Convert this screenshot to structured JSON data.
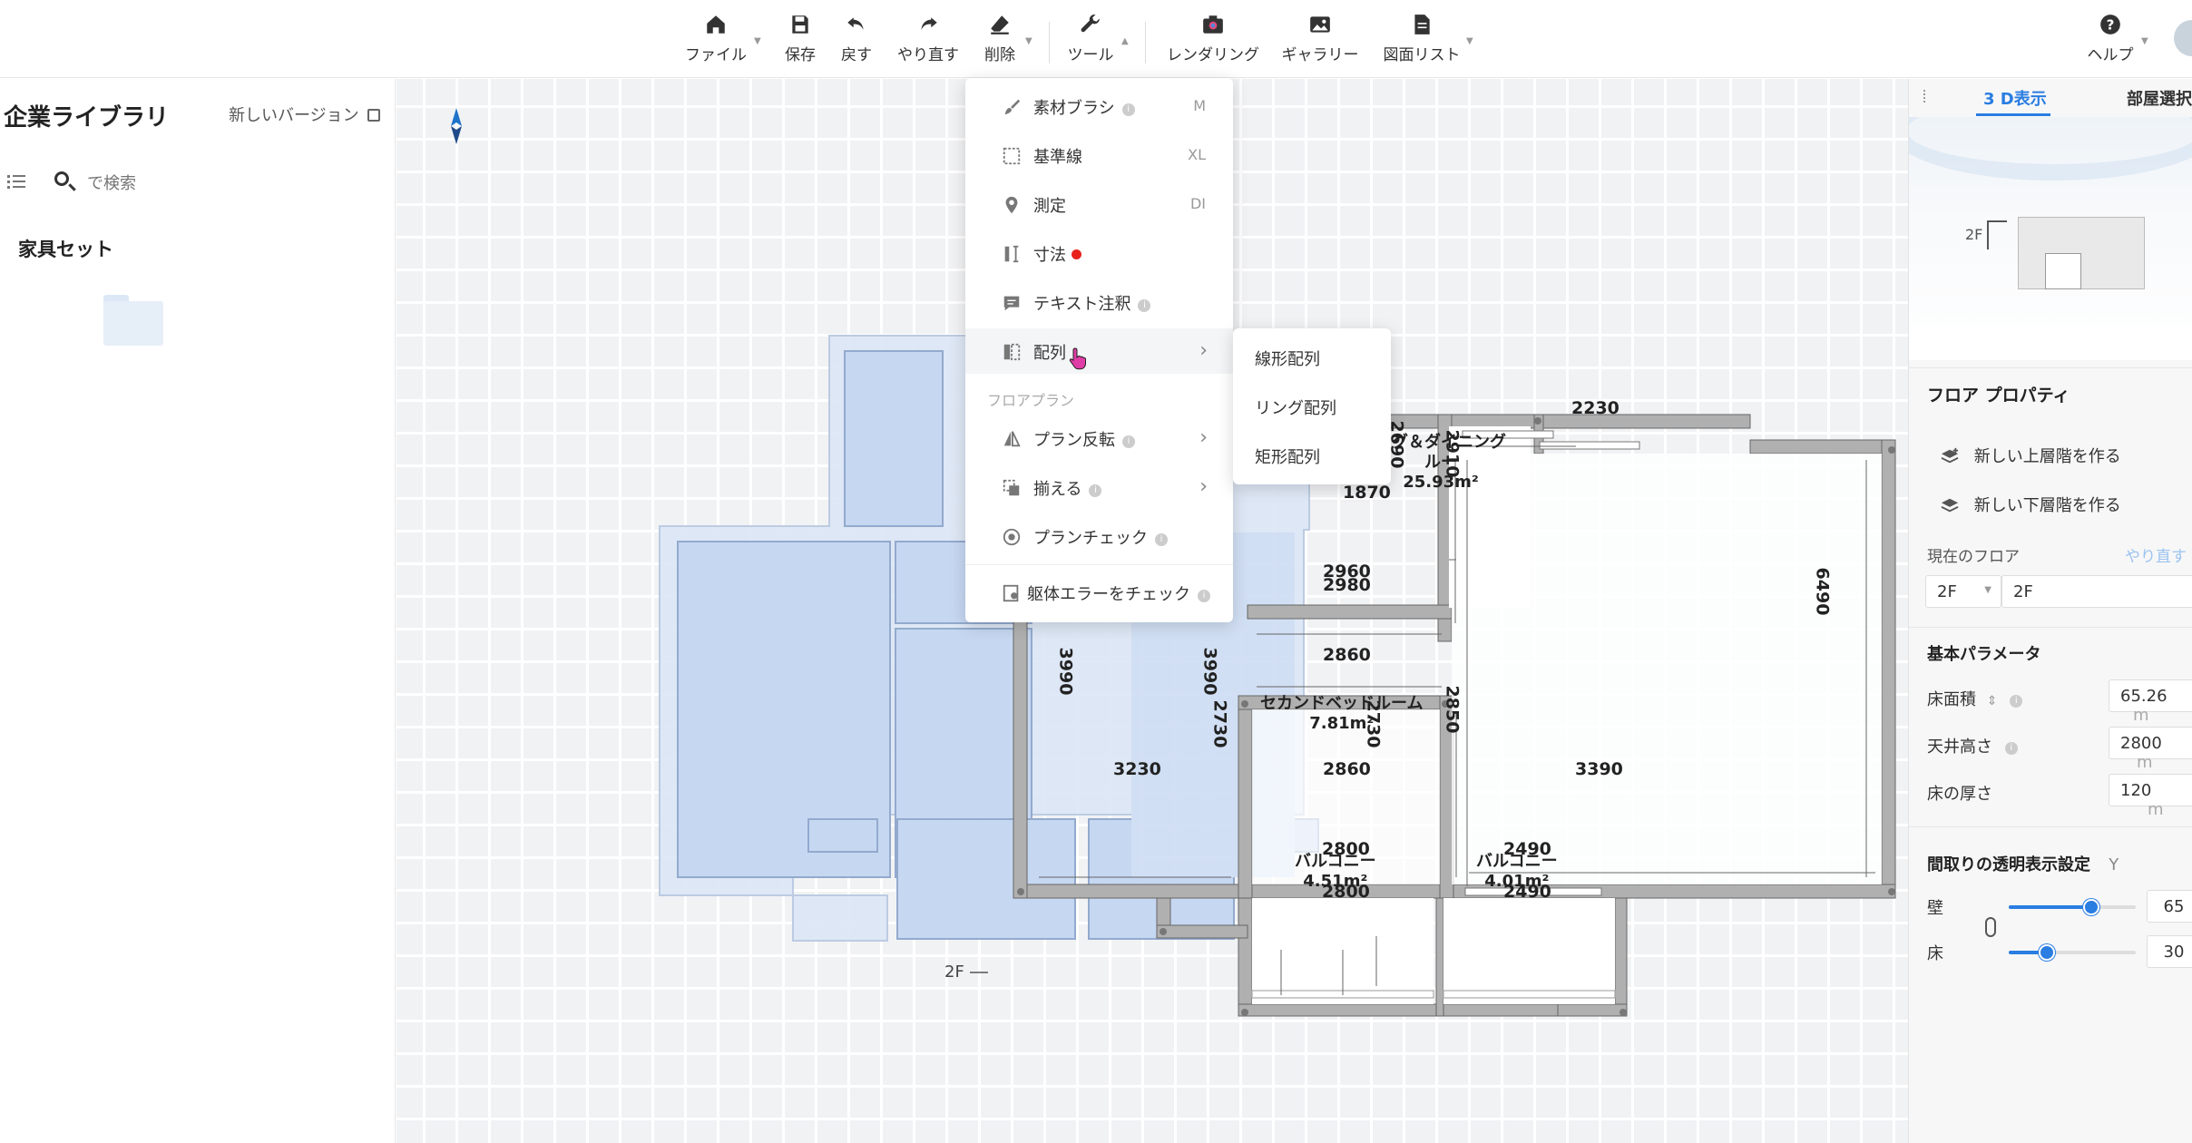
{
  "toolbar": {
    "items": [
      {
        "label": "ファイル",
        "icon": "home-icon"
      },
      {
        "label": "保存",
        "icon": "save-icon"
      },
      {
        "label": "戻す",
        "icon": "undo-icon"
      },
      {
        "label": "やり直す",
        "icon": "redo-icon"
      },
      {
        "label": "削除",
        "icon": "eraser-icon"
      },
      {
        "label": "ツール",
        "icon": "wrench-icon"
      },
      {
        "label": "レンダリング",
        "icon": "camera-icon"
      },
      {
        "label": "ギャラリー",
        "icon": "image-icon"
      },
      {
        "label": "図面リスト",
        "icon": "document-icon"
      },
      {
        "label": "ヘルプ",
        "icon": "help-icon"
      }
    ]
  },
  "sidebar": {
    "title": "企業ライブラリ",
    "version_link": "新しいバージョン",
    "search_placeholder": "で検索",
    "section_title": "家具セット"
  },
  "tools_menu": {
    "items": [
      {
        "label": "素材ブラシ",
        "shortcut": "M",
        "icon": "brush-icon",
        "info": true
      },
      {
        "label": "基準線",
        "shortcut": "XL",
        "icon": "guideline-icon"
      },
      {
        "label": "測定",
        "shortcut": "DI",
        "icon": "measure-pin-icon"
      },
      {
        "label": "寸法",
        "icon": "dimension-icon",
        "badge": "red-dot"
      },
      {
        "label": "テキスト注釈",
        "icon": "comment-icon",
        "info": true
      },
      {
        "label": "配列",
        "icon": "array-icon",
        "submenu": true
      }
    ],
    "group_label": "フロアプラン",
    "group_items": [
      {
        "label": "プラン反転",
        "icon": "flip-icon",
        "info": true,
        "submenu": true
      },
      {
        "label": "揃える",
        "icon": "align-icon",
        "info": true,
        "submenu": true
      },
      {
        "label": "プランチェック",
        "icon": "check-icon",
        "info": true
      }
    ],
    "footer_item": {
      "label": "躯体エラーをチェック",
      "icon": "structure-check-icon",
      "info": true
    }
  },
  "array_submenu": {
    "items": [
      "線形配列",
      "リング配列",
      "矩形配列"
    ]
  },
  "canvas": {
    "floor_label": "2F",
    "rooms": [
      {
        "name": "リビング＆ダイニング ルーム",
        "visible_name": "ング＆ダイニング",
        "second_line": "ルー",
        "area": "25.93m²"
      },
      {
        "name": "セカンドベッドルーム",
        "visible_name": "セカンドベッドルーム",
        "area": "7.81m²"
      },
      {
        "name": "バルコニー",
        "area": "4.51m²"
      },
      {
        "name": "バルコニー",
        "area": "4.01m²"
      }
    ],
    "dimensions": {
      "d2230": "2230",
      "d1870": "1870",
      "d2960": "2960",
      "d2980": "2980",
      "d2860a": "2860",
      "d2860b": "2860",
      "d3230": "3230",
      "d3390": "3390",
      "d2800a": "2800",
      "d2800b": "2800",
      "d2490a": "2490",
      "d2490b": "2490",
      "v3990a": "3990",
      "v3990b": "3990",
      "v2730a": "2730",
      "v2730b": "2730",
      "v2850": "2850",
      "v6490": "6490",
      "v2910": "2910",
      "v2690": "2690"
    }
  },
  "right_panel": {
    "tabs": [
      "3 D表示",
      "部屋選択"
    ],
    "preview_floor_label": "2F",
    "floor_properties_title": "フロア プロパティ",
    "new_upper_floor": "新しい上層階を作る",
    "new_lower_floor": "新しい下層階を作る",
    "current_floor_label": "現在のフロア",
    "redo_link": "やり直す",
    "floor_select": "2F",
    "floor_name": "2F",
    "basic_params_title": "基本パラメータ",
    "floor_area_label": "床面積",
    "floor_area_value": "65.26",
    "floor_area_unit": "m",
    "ceiling_height_label": "天井高さ",
    "ceiling_height_value": "2800",
    "ceiling_height_unit": "m",
    "floor_thickness_label": "床の厚さ",
    "floor_thickness_value": "120",
    "floor_thickness_unit": "m",
    "transparency_title": "間取りの透明表示設定",
    "transparency_shortcut": "Y",
    "wall_label": "壁",
    "wall_value": "65",
    "wall_fraction": 0.65,
    "floor_label": "床",
    "floor_value": "30",
    "floor_fraction": 0.3,
    "accent_color": "#2a7de1"
  }
}
